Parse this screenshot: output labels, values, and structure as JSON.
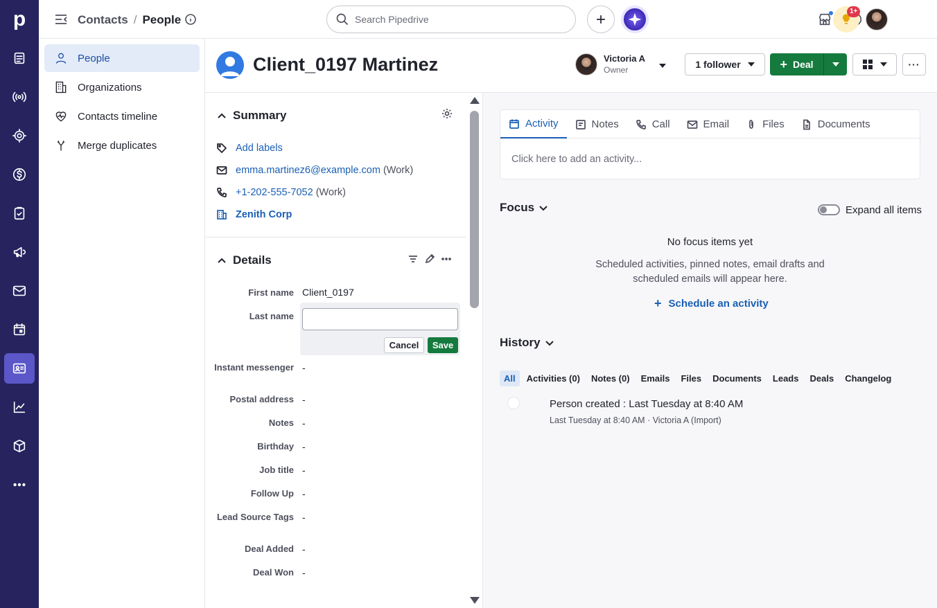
{
  "colors": {
    "rail_bg": "#26235f",
    "rail_active": "#5b57c8",
    "primary_green": "#157a3e",
    "link_blue": "#1a5fb4",
    "badge_red": "#e0394b"
  },
  "rail": {
    "logo": "p",
    "icons": [
      "leads-inbox-icon",
      "broadcast-icon",
      "target-icon",
      "dollar-icon",
      "tasks-icon",
      "megaphone-icon",
      "mail-icon",
      "calendar-icon",
      "contacts-icon",
      "chart-icon",
      "box-icon",
      "more-icon"
    ],
    "active_icon": "contacts-icon"
  },
  "topbar": {
    "breadcrumb_parent": "Contacts",
    "breadcrumb_sep": "/",
    "breadcrumb_current": "People",
    "search_placeholder": "Search Pipedrive",
    "notifications_badge": "1+"
  },
  "sidebar": {
    "items": [
      {
        "label": "People",
        "icon": "person-icon",
        "active": true
      },
      {
        "label": "Organizations",
        "icon": "building-icon",
        "active": false
      },
      {
        "label": "Contacts timeline",
        "icon": "heart-pulse-icon",
        "active": false
      },
      {
        "label": "Merge duplicates",
        "icon": "merge-icon",
        "active": false
      }
    ]
  },
  "person": {
    "name": "Client_0197 Martinez",
    "owner_name": "Victoria A",
    "owner_role": "Owner",
    "follower_label": "1 follower",
    "deal_label": "Deal",
    "more_label": "···"
  },
  "summary": {
    "title": "Summary",
    "add_labels": "Add labels",
    "email": "emma.martinez6@example.com",
    "email_type": "(Work)",
    "phone": "+1-202-555-7052",
    "phone_type": "(Work)",
    "organization": "Zenith Corp"
  },
  "details": {
    "title": "Details",
    "fields": [
      {
        "label": "First name",
        "value": "Client_0197"
      },
      {
        "label": "Last name",
        "value": ""
      },
      {
        "label": "Instant messenger",
        "value": "-"
      },
      {
        "label": "Postal address",
        "value": "-"
      },
      {
        "label": "Notes",
        "value": "-"
      },
      {
        "label": "Birthday",
        "value": "-"
      },
      {
        "label": "Job title",
        "value": "-"
      },
      {
        "label": "Follow Up",
        "value": "-"
      },
      {
        "label": "Lead Source Tags",
        "value": "-"
      },
      {
        "label": "Deal Added",
        "value": "-"
      },
      {
        "label": "Deal Won",
        "value": "-"
      }
    ],
    "edit_cancel": "Cancel",
    "edit_save": "Save"
  },
  "activity_tabs": [
    {
      "label": "Activity",
      "icon": "calendar-icon",
      "active": true
    },
    {
      "label": "Notes",
      "icon": "note-icon",
      "active": false
    },
    {
      "label": "Call",
      "icon": "phone-icon",
      "active": false
    },
    {
      "label": "Email",
      "icon": "mail-icon",
      "active": false
    },
    {
      "label": "Files",
      "icon": "paperclip-icon",
      "active": false
    },
    {
      "label": "Documents",
      "icon": "document-icon",
      "active": false
    }
  ],
  "activity_placeholder": "Click here to add an activity...",
  "focus": {
    "title": "Focus",
    "expand_label": "Expand all items",
    "empty_title": "No focus items yet",
    "empty_sub": "Scheduled activities, pinned notes, email drafts and scheduled emails will appear here.",
    "schedule_label": "Schedule an activity"
  },
  "history": {
    "title": "History",
    "tabs": [
      "All",
      "Activities (0)",
      "Notes (0)",
      "Emails",
      "Files",
      "Documents",
      "Leads",
      "Deals",
      "Changelog"
    ],
    "active_tab": "All",
    "entry_main": "Person created : Last Tuesday at 8:40 AM",
    "entry_sub": "Last Tuesday at 8:40 AM · Victoria A (Import)"
  }
}
